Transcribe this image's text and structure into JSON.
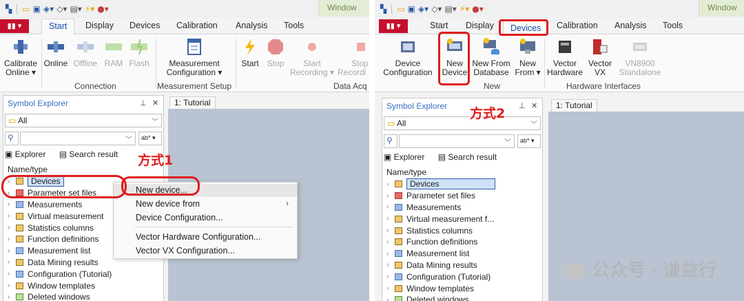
{
  "window_tab": "Window",
  "left": {
    "file_button": "▮▮ ▾",
    "tabs": [
      "Start",
      "Display",
      "Devices",
      "Calibration",
      "Analysis",
      "Tools"
    ],
    "active_tab": "Start",
    "ribbon": {
      "calibrate_online": "Calibrate",
      "calibrate_online_2": "Online ▾",
      "online": "Online",
      "offline": "Offline",
      "ram": "RAM",
      "flash": "Flash",
      "measurement_configuration": "Measurement",
      "measurement_configuration_2": "Configuration ▾",
      "start": "Start",
      "stop": "Stop",
      "start_recording": "Start",
      "start_recording_2": "Recording ▾",
      "stop_recording": "Stop",
      "stop_recording_2": "Recordi",
      "group_connection": "Connection",
      "group_measurement_setup": "Measurement Setup",
      "group_data_acq": "Data Acq"
    },
    "explorer": {
      "title": "Symbol Explorer",
      "pin": "📌",
      "close": "✕",
      "filter_value": "All",
      "search_placeholder": "",
      "ab_button": "ab* ▾",
      "subtab_explorer": "Explorer",
      "subtab_search": "Search result",
      "column_header": "Name/type",
      "items": [
        "Devices",
        "Parameter set files",
        "Measurements",
        "Virtual measurement",
        "Statistics columns",
        "Function definitions",
        "Measurement list",
        "Data Mining results",
        "Configuration (Tutorial)",
        "Window templates",
        "Deleted windows"
      ]
    },
    "doc_tab": "1: Tutorial",
    "context_menu": {
      "new_device": "New device...",
      "new_device_from": "New device from",
      "device_configuration": "Device Configuration...",
      "vector_hw_config": "Vector Hardware Configuration...",
      "vector_vx_config": "Vector VX  Configuration..."
    },
    "annotation": "方式1"
  },
  "right": {
    "file_button": "▮▮ ▾",
    "tabs": [
      "Start",
      "Display",
      "Devices",
      "Calibration",
      "Analysis",
      "Tools"
    ],
    "active_tab": "Devices",
    "ribbon": {
      "device_configuration": "Device",
      "device_configuration_2": "Configuration",
      "new_device": "New",
      "new_device_2": "Device",
      "new_from_database": "New From",
      "new_from_database_2": "Database",
      "new_from": "New",
      "new_from_2": "From ▾",
      "vector_hardware": "Vector",
      "vector_hardware_2": "Hardware",
      "vector_vx": "Vector",
      "vector_vx_2": "VX",
      "vn8900": "VN8900",
      "vn8900_2": "Standalone",
      "group_new": "New",
      "group_hw_interfaces": "Hardware Interfaces"
    },
    "explorer": {
      "title": "Symbol Explorer",
      "pin": "📌",
      "close": "✕",
      "filter_value": "All",
      "ab_button": "ab* ▾",
      "subtab_explorer": "Explorer",
      "subtab_search": "Search result",
      "column_header": "Name/type",
      "items": [
        "Devices",
        "Parameter set files",
        "Measurements",
        "Virtual measurement f...",
        "Statistics columns",
        "Function definitions",
        "Measurement list",
        "Data Mining results",
        "Configuration (Tutorial)",
        "Window templates",
        "Deleted windows"
      ]
    },
    "doc_tab": "1: Tutorial",
    "annotation": "方式2"
  },
  "watermark": "公众号 · 谦益行"
}
